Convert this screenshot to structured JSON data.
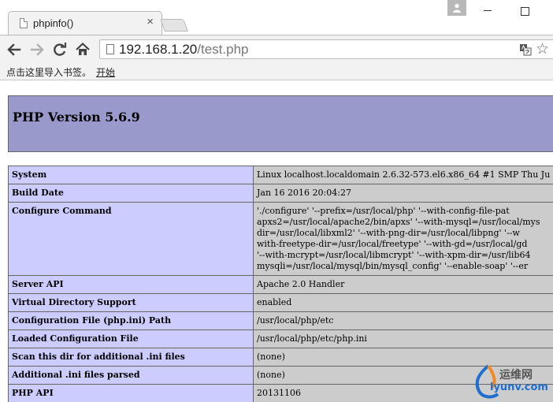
{
  "browser": {
    "tab_title": "phpinfo()",
    "tab_close": "×",
    "url_host": "192.168.1.20",
    "url_path": "/test.php",
    "star_glyph": "☆"
  },
  "bookmarks": {
    "hint": "点击这里导入书签。",
    "link": "开始"
  },
  "page": {
    "title": "PHP Version 5.6.9",
    "header_color": "#9999cc",
    "label_color": "#ccccff",
    "value_color": "#cccccc",
    "rows": [
      {
        "label": "System",
        "lines": [
          "Linux localhost.localdomain 2.6.32-573.el6.x86_64 #1 SMP Thu Ju"
        ]
      },
      {
        "label": "Build Date",
        "lines": [
          "Jan 16 2016 20:04:27"
        ]
      },
      {
        "label": "Configure Command",
        "lines": [
          "'./configure' '--prefix=/usr/local/php' '--with-config-file-pat",
          "apxs2=/usr/local/apache2/bin/apxs' '--with-mysql=/usr/local/mys",
          "dir=/usr/local/libxml2' '--with-png-dir=/usr/local/libpng' '--w",
          "with-freetype-dir=/usr/local/freetype' '--with-gd=/usr/local/gd",
          "'--with-mcrypt=/usr/local/libmcrypt' '--with-xpm-dir=/usr/lib64",
          "mysqli=/usr/local/mysql/bin/mysql_config' '--enable-soap' '--er"
        ]
      },
      {
        "label": "Server API",
        "lines": [
          "Apache 2.0 Handler"
        ]
      },
      {
        "label": "Virtual Directory Support",
        "lines": [
          "enabled"
        ]
      },
      {
        "label": "Configuration File (php.ini) Path",
        "lines": [
          "/usr/local/php/etc"
        ]
      },
      {
        "label": "Loaded Configuration File",
        "lines": [
          "/usr/local/php/etc/php.ini"
        ]
      },
      {
        "label": "Scan this dir for additional .ini files",
        "lines": [
          "(none)"
        ]
      },
      {
        "label": "Additional .ini files parsed",
        "lines": [
          "(none)"
        ]
      },
      {
        "label": "PHP API",
        "lines": [
          "20131106"
        ]
      }
    ]
  },
  "watermark": {
    "cn": "运维网",
    "en": "iyunv.com"
  }
}
